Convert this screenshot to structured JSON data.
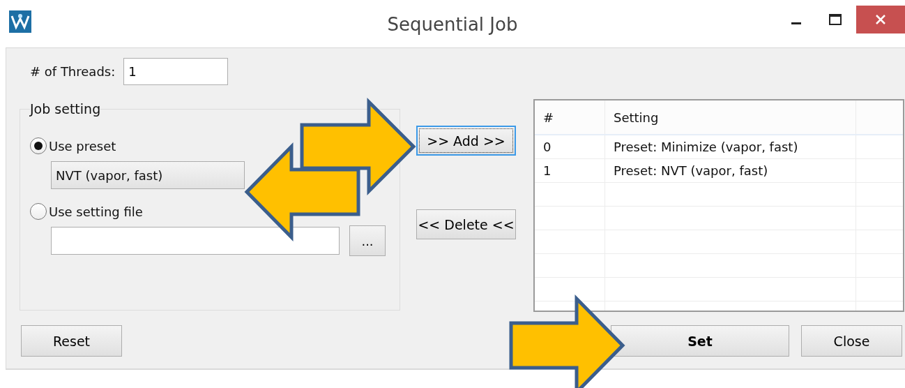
{
  "window": {
    "title": "Sequential Job"
  },
  "threads": {
    "label": "# of Threads:",
    "value": "1"
  },
  "job_setting": {
    "title": "Job setting",
    "options": [
      {
        "label": "Use preset",
        "selected": true
      },
      {
        "label": "Use setting file",
        "selected": false
      }
    ],
    "preset_dropdown": {
      "value": "NVT (vapor, fast)"
    },
    "browse_button": "..."
  },
  "add_button": {
    "label": ">> Add >>",
    "focused": true
  },
  "delete_button": {
    "label": "<< Delete <<",
    "focused": false
  },
  "table": {
    "columns": [
      "#",
      "Setting"
    ],
    "rows": [
      {
        "index": "0",
        "setting": "Preset: Minimize (vapor, fast)"
      },
      {
        "index": "1",
        "setting": "Preset: NVT (vapor, fast)"
      }
    ]
  },
  "bottom_buttons": [
    {
      "label": "Reset",
      "kind": "reset"
    },
    {
      "label": "Set",
      "kind": "default"
    },
    {
      "label": "Close",
      "kind": "close"
    }
  ],
  "annotations": [
    {
      "kind": "arrow",
      "points_left": false
    },
    {
      "kind": "arrow",
      "points_left": true
    },
    {
      "kind": "arrow",
      "points_left": false
    }
  ]
}
